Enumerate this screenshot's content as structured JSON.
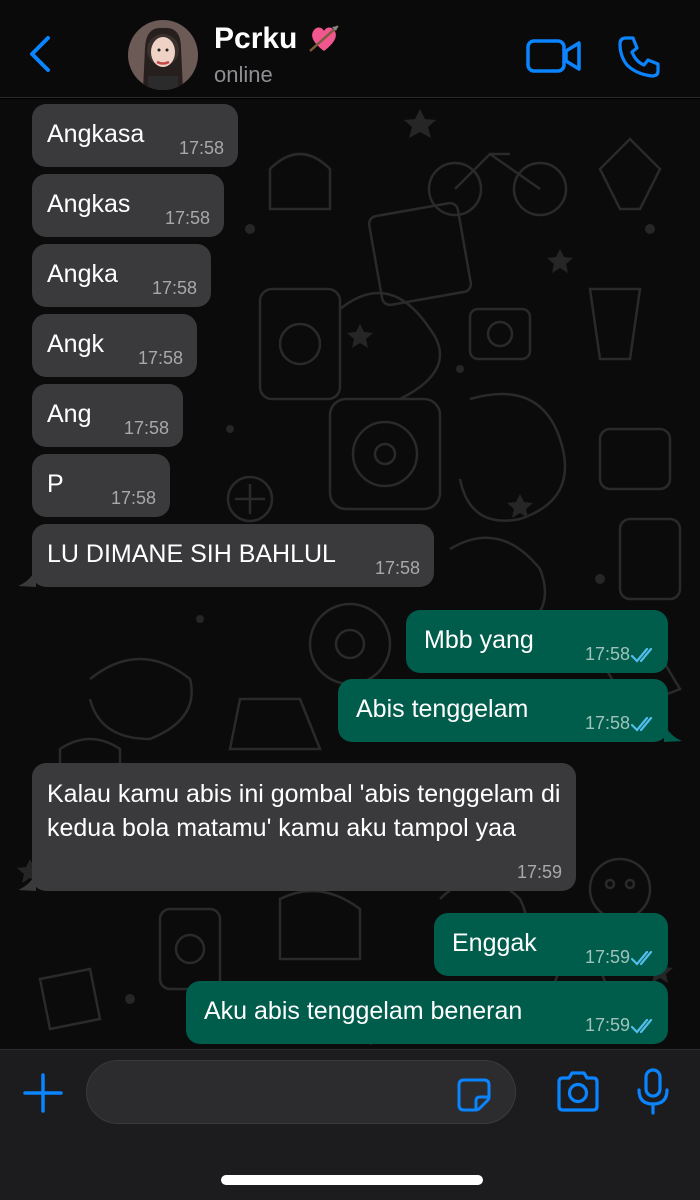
{
  "header": {
    "contact_name": "Pcrku",
    "status": "online",
    "back_icon": "chevron-left-icon",
    "video_icon": "video-camera-icon",
    "phone_icon": "phone-icon",
    "accent_color": "#0a84ff"
  },
  "messages": [
    {
      "direction": "in",
      "text": "Angkasa",
      "time": "17:58"
    },
    {
      "direction": "in",
      "text": "Angkas",
      "time": "17:58"
    },
    {
      "direction": "in",
      "text": "Angka",
      "time": "17:58"
    },
    {
      "direction": "in",
      "text": "Angk",
      "time": "17:58"
    },
    {
      "direction": "in",
      "text": "Ang",
      "time": "17:58"
    },
    {
      "direction": "in",
      "text": "P",
      "time": "17:58"
    },
    {
      "direction": "in",
      "text": "LU DIMANE SIH BAHLUL",
      "time": "17:58"
    },
    {
      "direction": "out",
      "text": "Mbb yang",
      "time": "17:58",
      "read": true
    },
    {
      "direction": "out",
      "text": "Abis tenggelam",
      "time": "17:58",
      "read": true
    },
    {
      "direction": "in",
      "text": "Kalau kamu abis ini gombal 'abis tenggelam di kedua bola matamu' kamu aku tampol yaa",
      "time": "17:59"
    },
    {
      "direction": "out",
      "text": "Enggak",
      "time": "17:59",
      "read": true
    },
    {
      "direction": "out",
      "text": "Aku abis tenggelam beneran",
      "time": "17:59",
      "read": true
    }
  ],
  "composer": {
    "value": "",
    "placeholder": "",
    "plus_icon": "plus-icon",
    "sticker_icon": "sticker-icon",
    "camera_icon": "camera-icon",
    "mic_icon": "microphone-icon"
  },
  "colors": {
    "incoming_bubble": "#3a3a3c",
    "outgoing_bubble": "#005c4b",
    "read_ticks": "#53bdeb"
  }
}
